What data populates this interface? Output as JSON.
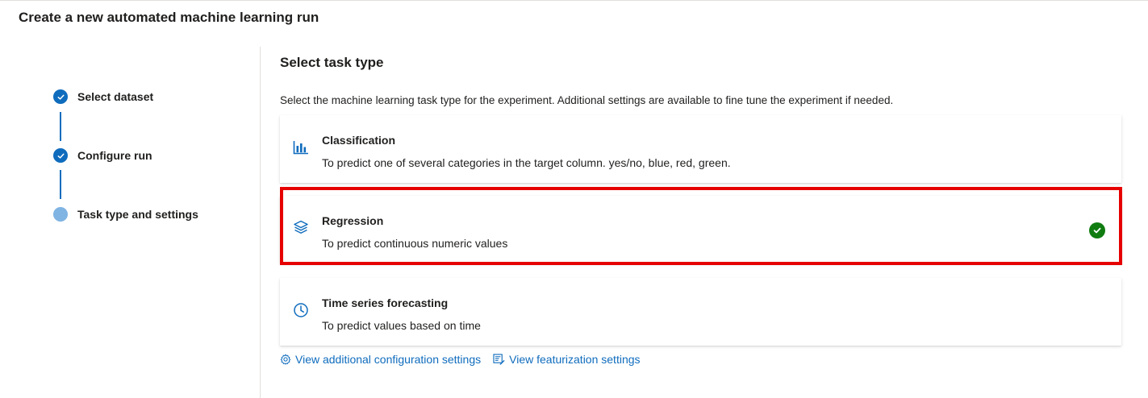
{
  "page": {
    "title": "Create a new automated machine learning run"
  },
  "stepper": {
    "steps": [
      {
        "label": "Select dataset",
        "state": "completed"
      },
      {
        "label": "Configure run",
        "state": "completed"
      },
      {
        "label": "Task type and settings",
        "state": "current"
      }
    ]
  },
  "main": {
    "title": "Select task type",
    "description": "Select the machine learning task type for the experiment. Additional settings are available to fine tune the experiment if needed.",
    "task_types": [
      {
        "icon": "bar-chart-icon",
        "title": "Classification",
        "description": "To predict one of several categories in the target column. yes/no, blue, red, green.",
        "selected": false
      },
      {
        "icon": "stacked-layers-icon",
        "title": "Regression",
        "description": "To predict continuous numeric values",
        "selected": true
      },
      {
        "icon": "clock-icon",
        "title": "Time series forecasting",
        "description": "To predict values based on time",
        "selected": false
      }
    ],
    "links": [
      {
        "icon": "gear-icon",
        "label": "View additional configuration settings"
      },
      {
        "icon": "featurization-icon",
        "label": "View featurization settings"
      }
    ]
  },
  "colors": {
    "accent": "#0f6cbd",
    "current_step": "#7fb4e3",
    "selected_check": "#107c10",
    "highlight_outline": "#e60000"
  }
}
